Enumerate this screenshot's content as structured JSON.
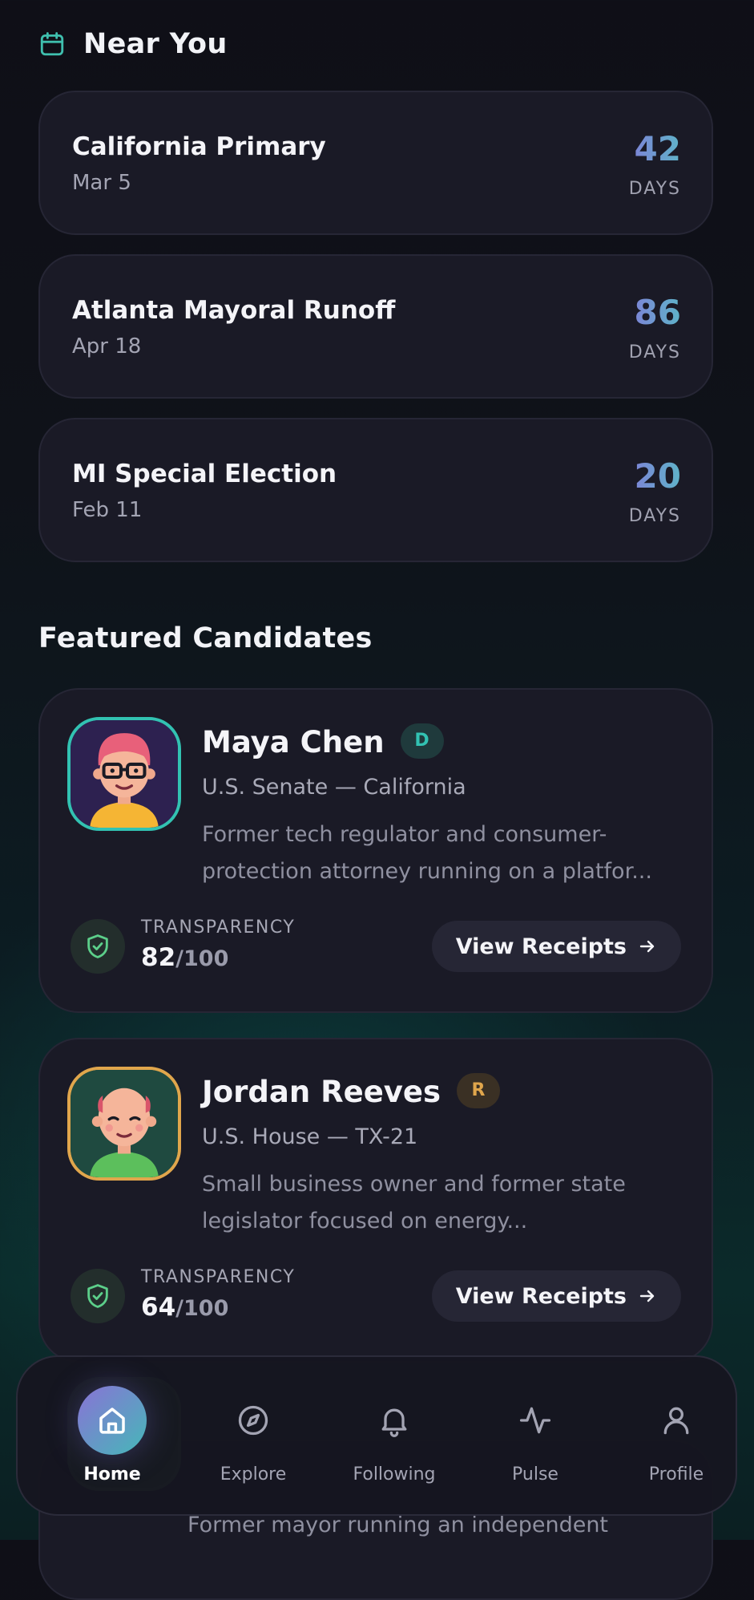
{
  "near_you": {
    "title": "Near You",
    "events": [
      {
        "name": "California Primary",
        "date": "Mar 5",
        "days": "42",
        "unit": "DAYS"
      },
      {
        "name": "Atlanta Mayoral Runoff",
        "date": "Apr 18",
        "days": "86",
        "unit": "DAYS"
      },
      {
        "name": "MI Special Election",
        "date": "Feb 11",
        "days": "20",
        "unit": "DAYS"
      }
    ]
  },
  "featured": {
    "title": "Featured Candidates",
    "candidates": [
      {
        "name": "Maya Chen",
        "party": "D",
        "office": "U.S. Senate — California",
        "bio": "Former tech regulator and consumer-protection attorney running on a platfor...",
        "transparency_label": "TRANSPARENCY",
        "score": "82",
        "score_max": "/100",
        "button": "View Receipts"
      },
      {
        "name": "Jordan Reeves",
        "party": "R",
        "office": "U.S. House — TX-21",
        "bio": "Small business owner and former state legislator focused on energy...",
        "transparency_label": "TRANSPARENCY",
        "score": "64",
        "score_max": "/100",
        "button": "View Receipts"
      }
    ],
    "peek_bio": "Former mayor running an independent"
  },
  "nav": {
    "items": [
      {
        "label": "Home",
        "icon": "home-icon",
        "active": true
      },
      {
        "label": "Explore",
        "icon": "compass-icon"
      },
      {
        "label": "Following",
        "icon": "bell-icon"
      },
      {
        "label": "Pulse",
        "icon": "pulse-icon"
      },
      {
        "label": "Profile",
        "icon": "user-icon"
      }
    ]
  },
  "colors": {
    "accent_teal": "#3fbfae",
    "party_d": "#32c2b2",
    "party_r": "#e0a64c",
    "shield": "#5ccf8a"
  }
}
